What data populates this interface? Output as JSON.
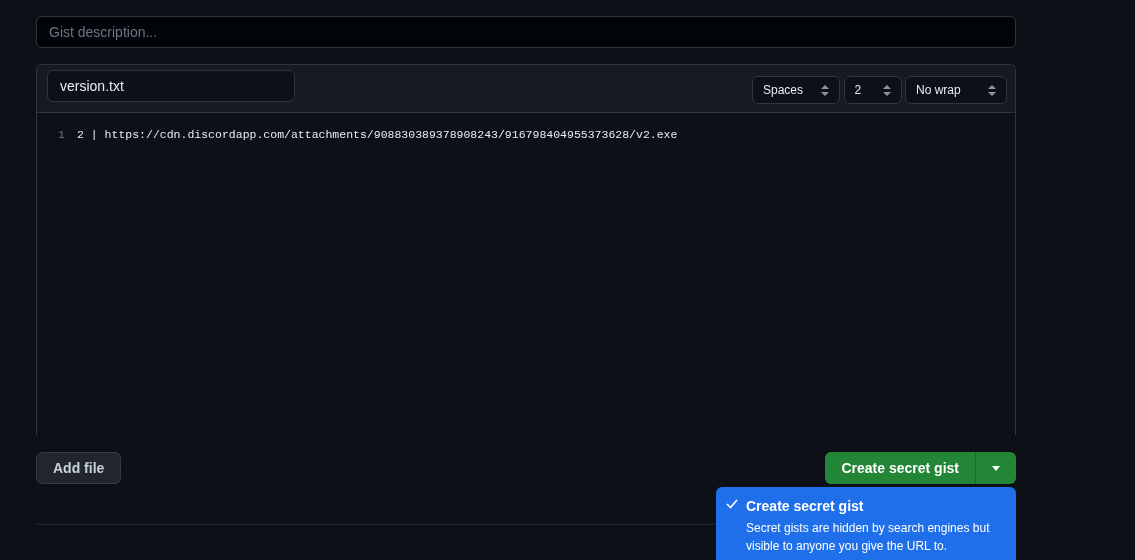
{
  "description": {
    "placeholder": "Gist description..."
  },
  "file": {
    "name": "version.txt",
    "indent_mode": "Spaces",
    "indent_size": "2",
    "wrap_mode": "No wrap",
    "lines": [
      {
        "number": "1",
        "text": "2 | https://cdn.discordapp.com/attachments/908830389378908243/916798404955373628/v2.exe"
      }
    ]
  },
  "add_file_button": "Add file",
  "create_button": {
    "label": "Create secret gist",
    "menu_expanded": true
  },
  "menu": [
    {
      "title": "Create secret gist",
      "text": "Secret gists are hidden by search engines but visible to anyone you give the URL to.",
      "selected": true
    }
  ]
}
